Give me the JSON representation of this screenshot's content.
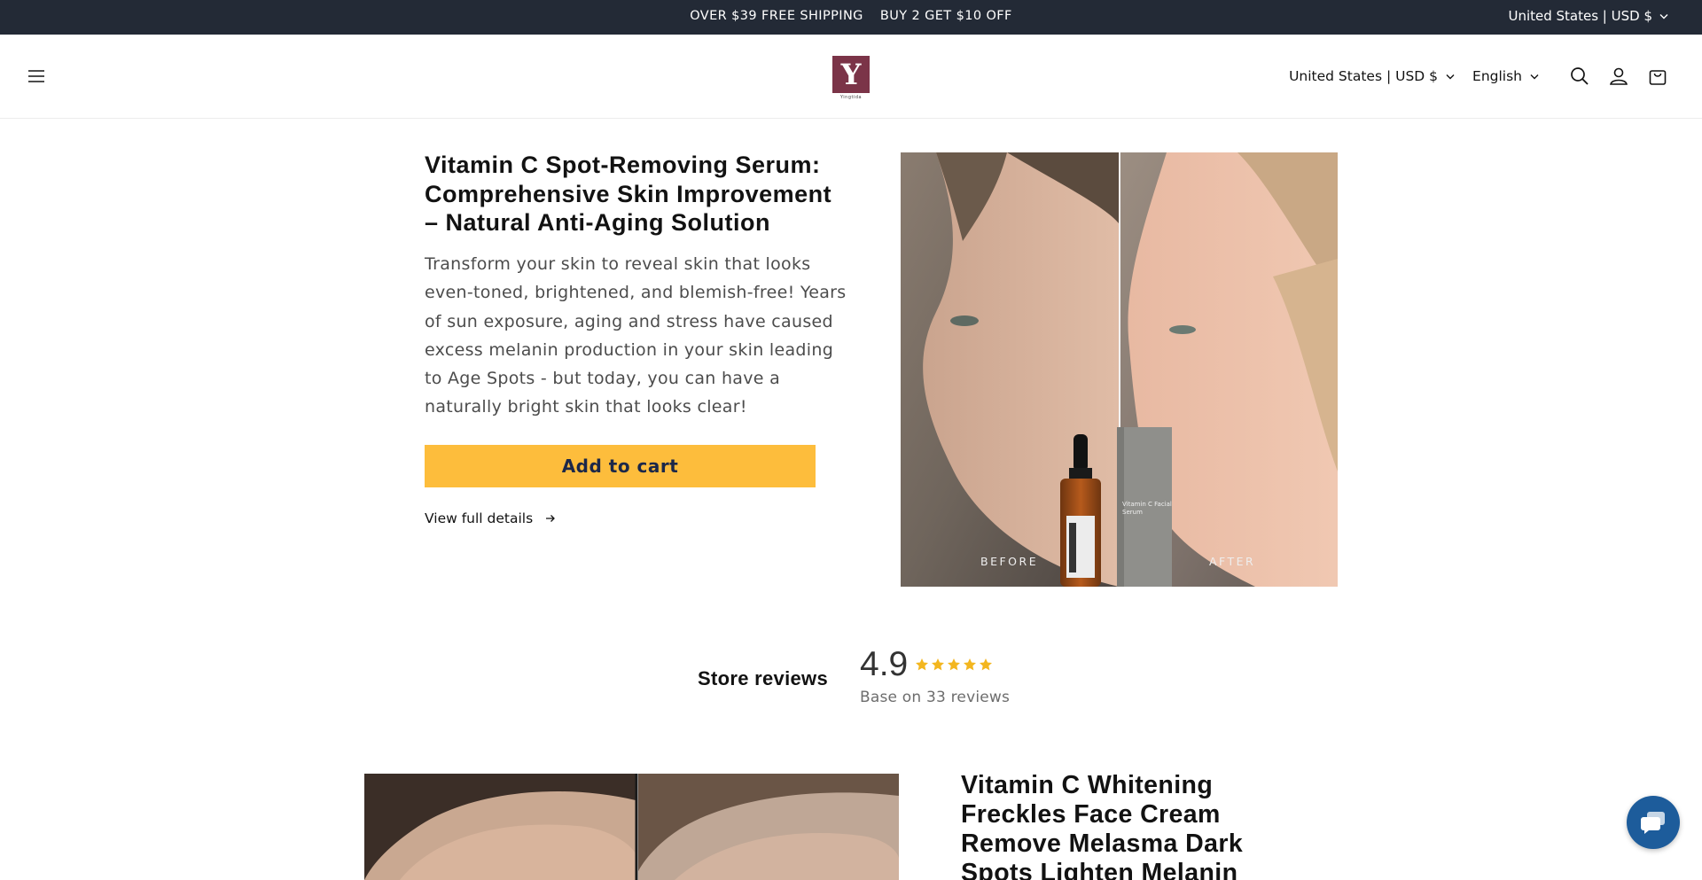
{
  "announcement": {
    "shipping": "OVER $39 FREE SHIPPING",
    "promo": "BUY 2 GET $10 OFF",
    "locale": "United States | USD $"
  },
  "header": {
    "logo_letter": "Y",
    "logo_text": "Yingtida",
    "country": "United States | USD $",
    "language": "English",
    "icons": [
      "menu-icon",
      "search-icon",
      "account-icon",
      "cart-icon"
    ]
  },
  "product": {
    "title": "Vitamin C Spot-Removing Serum: Comprehensive Skin Improvement – Natural Anti-Aging Solution",
    "description": "Transform your skin to reveal skin that looks even-toned, brightened, and blemish-free! Years of sun exposure, aging and stress have caused excess melanin production in your skin leading to Age Spots - but today, you can have a naturally bright skin that looks clear!",
    "add_to_cart": "Add to cart",
    "view_details": "View full details",
    "image": {
      "before_label": "BEFORE",
      "after_label": "AFTER",
      "box_label_line1": "Vitamin C Facial",
      "box_label_line2": "Serum"
    }
  },
  "reviews": {
    "label": "Store reviews",
    "score": "4.9",
    "stars": 5,
    "base": "Base on 33 reviews"
  },
  "product2": {
    "title": "Vitamin C Whitening Freckles Face Cream Remove Melasma Dark Spots Lighten Melanin"
  },
  "colors": {
    "announcement_bg": "#232a36",
    "button_bg": "#fdbd3c",
    "button_text": "#1c2849",
    "star": "#f3b61f",
    "chat_bg": "#1d5c9b",
    "logo_bg": "#7b3448"
  }
}
